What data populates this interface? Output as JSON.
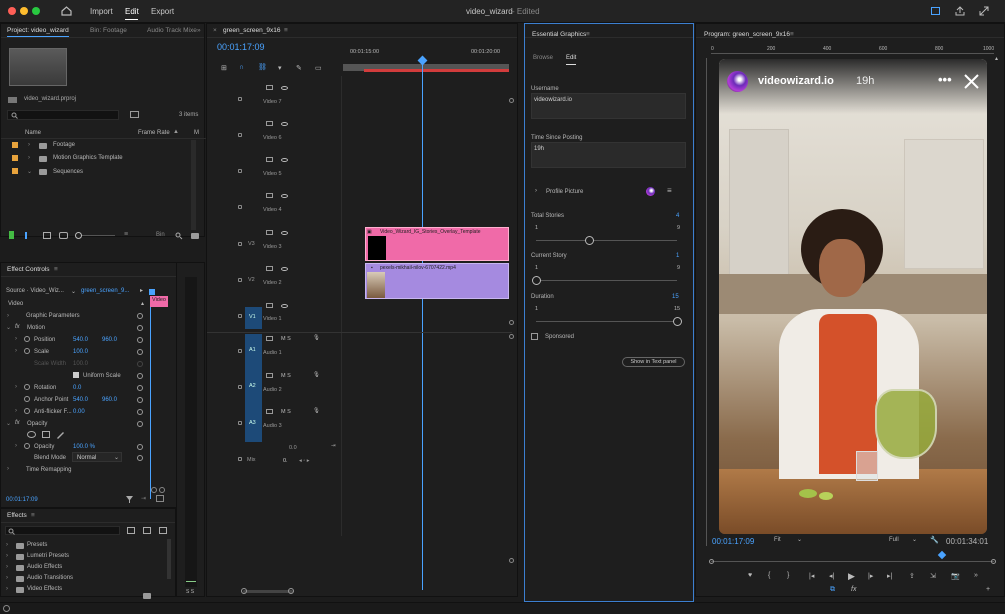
{
  "window": {
    "title": "video_wizard",
    "status": "- Edited",
    "menu": [
      "Import",
      "Edit",
      "Export"
    ]
  },
  "project_panel": {
    "tabs": [
      "Project: video_wizard",
      "Bin: Footage",
      "Audio Track Mixe"
    ],
    "file": "video_wizard.prproj",
    "items_count": "3 items",
    "columns": [
      "Name",
      "Frame Rate",
      "M"
    ],
    "folders": [
      "Footage",
      "Motion Graphics Template",
      "Sequences"
    ],
    "bin_label": "Bin"
  },
  "effect_controls": {
    "title": "Effect Controls",
    "source": "Source · Video_Wiz...",
    "sequence": "green_screen_9...",
    "video_label": "Video",
    "clip_tag": "Video",
    "rows": {
      "graphic_params": "Graphic Parameters",
      "motion": "Motion",
      "position": "Position",
      "position_x": "540.0",
      "position_y": "960.0",
      "scale": "Scale",
      "scale_val": "100.0",
      "scale_width": "Scale Width",
      "scale_width_val": "100.0",
      "uniform_scale": "Uniform Scale",
      "rotation": "Rotation",
      "rotation_val": "0.0",
      "anchor": "Anchor Point",
      "anchor_x": "540.0",
      "anchor_y": "960.0",
      "antiflicker": "Anti-flicker F...",
      "antiflicker_val": "0.00",
      "opacity": "Opacity",
      "opacity_row": "Opacity",
      "opacity_val": "100.0 %",
      "blend": "Blend Mode",
      "blend_val": "Normal",
      "time_remap": "Time Remapping"
    },
    "timecode": "00:01:17:09"
  },
  "effects_panel": {
    "title": "Effects",
    "items": [
      "Presets",
      "Lumetri Presets",
      "Audio Effects",
      "Audio Transitions",
      "Video Effects"
    ]
  },
  "timeline": {
    "tab": "green_screen_9x16",
    "timecode": "00:01:17:09",
    "ruler": [
      "00:01:15:00",
      "00:01:20:00"
    ],
    "video_tracks": [
      "Video 7",
      "Video 6",
      "Video 5",
      "Video 4",
      "Video 3",
      "Video 2",
      "Video 1"
    ],
    "track_ids": [
      "V3",
      "V2",
      "V1",
      "A1",
      "A2",
      "A3"
    ],
    "audio_tracks": [
      "Audio 1",
      "Audio 2",
      "Audio 3"
    ],
    "clips": {
      "v3": "Video_Wizard_IG_Stories_Overlay_Template",
      "v2": "pexels-mikhail-nilov-6707422.mp4"
    },
    "mix": "Mix",
    "mix_val": "0.0",
    "mix_val2": "0.",
    "meter_label": "S S",
    "ms_letters": "M S"
  },
  "essential_graphics": {
    "title": "Essential Graphics",
    "tabs": [
      "Browse",
      "Edit"
    ],
    "username_label": "Username",
    "username_val": "videowizard.io",
    "time_label": "Time Since Posting",
    "time_val": "19h",
    "profile_label": "Profile Picture",
    "sliders": [
      {
        "label": "Total Stories",
        "value": "4",
        "min": "1",
        "max": "9",
        "fraction": 0.375
      },
      {
        "label": "Current Story",
        "value": "1",
        "min": "1",
        "max": "9",
        "fraction": 0.0
      },
      {
        "label": "Duration",
        "value": "15",
        "min": "1",
        "max": "15",
        "fraction": 1.0
      }
    ],
    "sponsored": "Sponsored",
    "show_text": "Show in Text panel"
  },
  "program_monitor": {
    "title": "Program: green_screen_9x16",
    "ruler": [
      "0",
      "200",
      "400",
      "600",
      "800",
      "1000"
    ],
    "story_user": "videowizard.io",
    "story_time": "19h",
    "timecode": "00:01:17:09",
    "fit": "Fit",
    "quality": "Full",
    "duration": "00:01:34:01"
  },
  "colors": {
    "accent": "#4aa3ff",
    "pink_clip": "#f06aa8",
    "purple_clip": "#a58ae0",
    "track_blue": "#1d4a78"
  }
}
